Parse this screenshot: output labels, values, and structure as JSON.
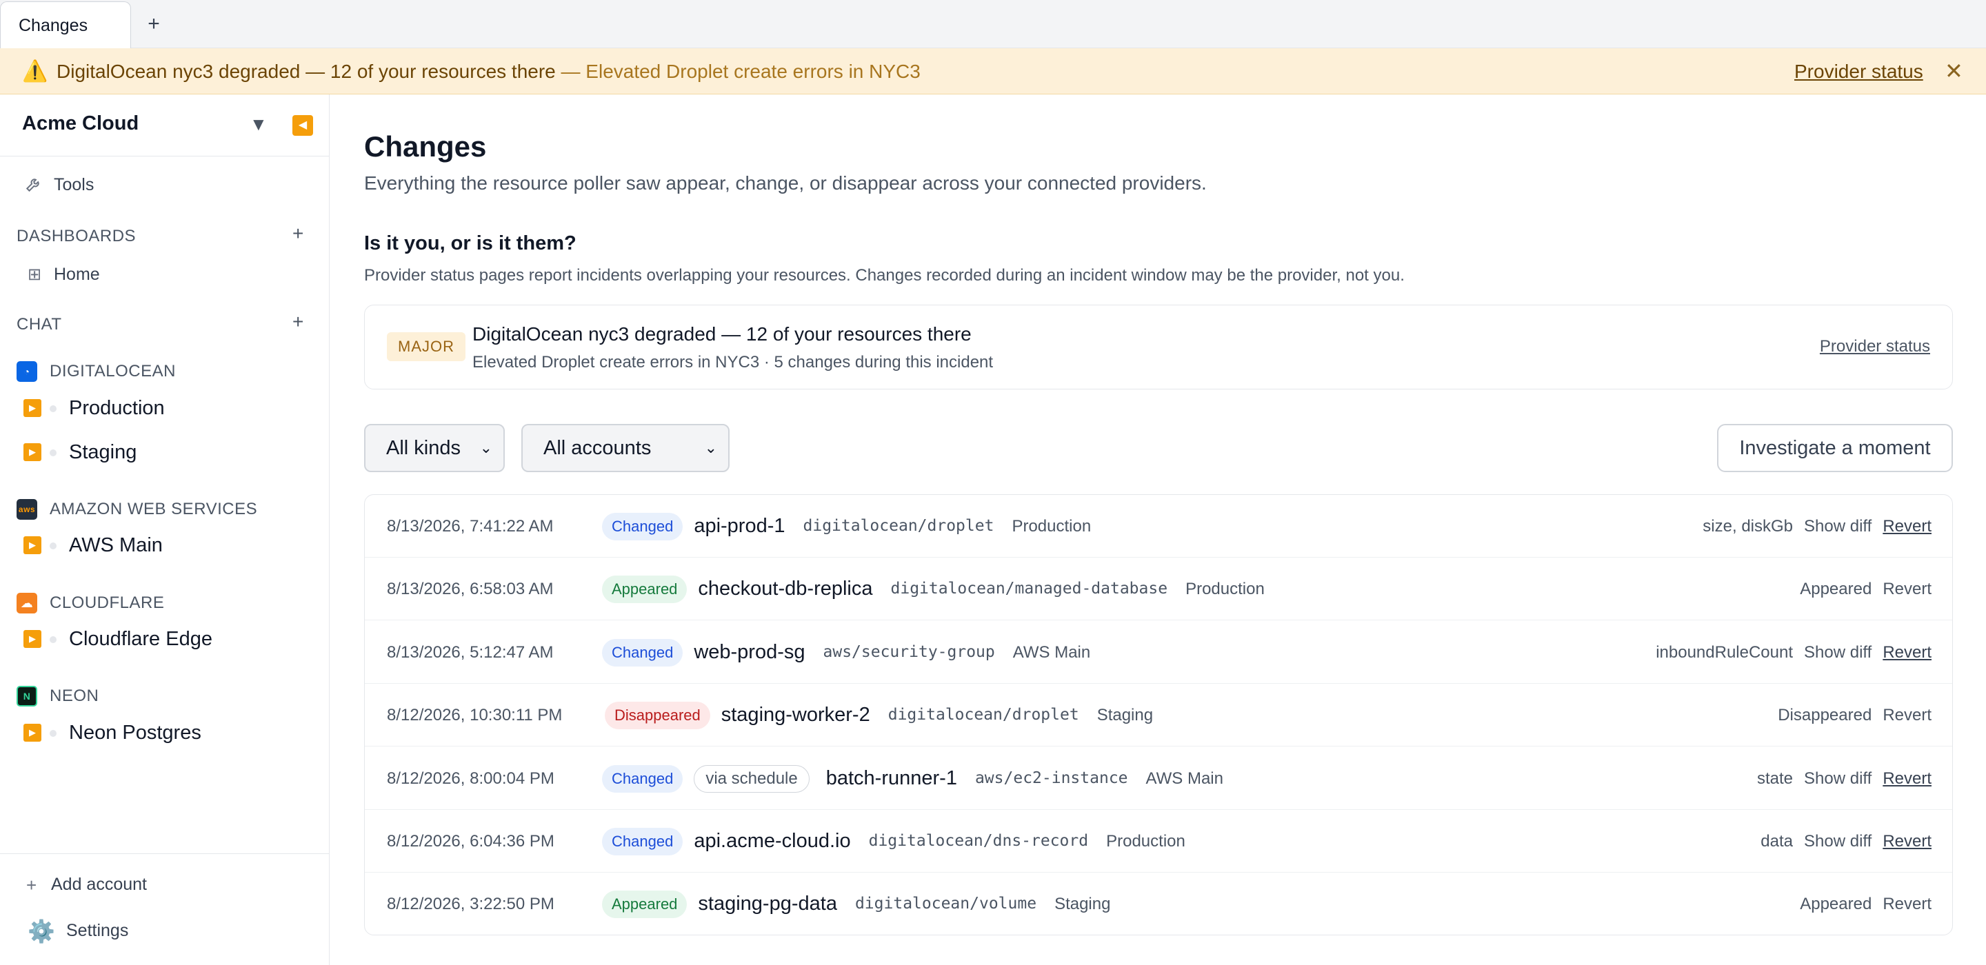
{
  "tabbar": {
    "tab_label": "Changes",
    "add_label": "+"
  },
  "banner": {
    "icon": "⚠️",
    "title": "DigitalOcean nyc3 degraded — 12 of your resources there",
    "subtitle": " — Elevated Droplet create errors in NYC3",
    "link": "Provider status",
    "close": "✕"
  },
  "sidebar": {
    "org": "Acme Cloud",
    "org_caret": "▼",
    "collapse_icon": "◀",
    "tools_label": "Tools",
    "dashboards_label": "DASHBOARDS",
    "home_label": "Home",
    "chat_label": "CHAT",
    "plus": "+",
    "providers": [
      {
        "name": "DIGITALOCEAN",
        "logo": "◔",
        "color": "#0a66e4",
        "accounts": [
          "Production",
          "Staging"
        ]
      },
      {
        "name": "AMAZON WEB SERVICES",
        "logo": "aws",
        "color": "#232f3e",
        "accounts": [
          "AWS Main"
        ]
      },
      {
        "name": "CLOUDFLARE",
        "logo": "☁",
        "color": "#f48120",
        "accounts": [
          "Cloudflare Edge"
        ]
      },
      {
        "name": "NEON",
        "logo": "N",
        "color": "#0b1d16",
        "accounts": [
          "Neon Postgres"
        ]
      }
    ],
    "add_account": "Add account",
    "settings": "Settings"
  },
  "main": {
    "title": "Changes",
    "description": "Everything the resource poller saw appear, change, or disappear across your connected providers.",
    "question_title": "Is it you, or is it them?",
    "question_desc": "Provider status pages report incidents overlapping your resources. Changes recorded during an incident window may be the provider, not you.",
    "incident": {
      "severity": "MAJOR",
      "title": "DigitalOcean nyc3 degraded — 12 of your resources there",
      "subtitle": "Elevated Droplet create errors in NYC3 · 5 changes during this incident",
      "link": "Provider status"
    },
    "filter_kinds": "All kinds",
    "filter_accounts": "All accounts",
    "investigate": "Investigate a moment"
  },
  "changes": [
    {
      "time": "8/13/2026, 7:41:22 AM",
      "status": "Changed",
      "via": "",
      "name": "api-prod-1",
      "kind": "digitalocean/droplet",
      "account": "Production",
      "fields": "size, diskGb",
      "diff": "Show diff",
      "action": "Revert"
    },
    {
      "time": "8/13/2026, 6:58:03 AM",
      "status": "Appeared",
      "via": "",
      "name": "checkout-db-replica",
      "kind": "digitalocean/managed-database",
      "account": "Production",
      "fields": "Appeared",
      "diff": "",
      "action": "Revert"
    },
    {
      "time": "8/13/2026, 5:12:47 AM",
      "status": "Changed",
      "via": "",
      "name": "web-prod-sg",
      "kind": "aws/security-group",
      "account": "AWS Main",
      "fields": "inboundRuleCount",
      "diff": "Show diff",
      "action": "Revert"
    },
    {
      "time": "8/12/2026, 10:30:11 PM",
      "status": "Disappeared",
      "via": "",
      "name": "staging-worker-2",
      "kind": "digitalocean/droplet",
      "account": "Staging",
      "fields": "Disappeared",
      "diff": "",
      "action": "Revert"
    },
    {
      "time": "8/12/2026, 8:00:04 PM",
      "status": "Changed",
      "via": "via schedule",
      "name": "batch-runner-1",
      "kind": "aws/ec2-instance",
      "account": "AWS Main",
      "fields": "state",
      "diff": "Show diff",
      "action": "Revert"
    },
    {
      "time": "8/12/2026, 6:04:36 PM",
      "status": "Changed",
      "via": "",
      "name": "api.acme-cloud.io",
      "kind": "digitalocean/dns-record",
      "account": "Production",
      "fields": "data",
      "diff": "Show diff",
      "action": "Revert"
    },
    {
      "time": "8/12/2026, 3:22:50 PM",
      "status": "Appeared",
      "via": "",
      "name": "staging-pg-data",
      "kind": "digitalocean/volume",
      "account": "Staging",
      "fields": "Appeared",
      "diff": "",
      "action": "Revert"
    }
  ]
}
